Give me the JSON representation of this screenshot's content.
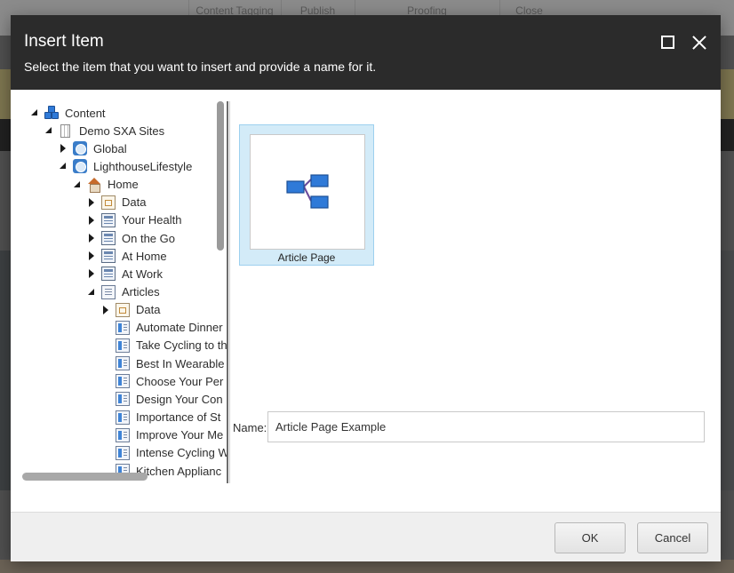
{
  "background": {
    "tabs": [
      "Content Tagging",
      "Publish",
      "Proofing",
      "Close"
    ]
  },
  "dialog": {
    "title": "Insert Item",
    "subtitle": "Select the item that you want to insert and provide a name for it.",
    "maximize_icon": "maximize-icon",
    "close_icon": "close-icon"
  },
  "tree": {
    "nodes": [
      {
        "label": "Content",
        "icon": "content-icon",
        "state": "expanded"
      },
      {
        "label": "Demo SXA Sites",
        "icon": "building-icon",
        "state": "expanded"
      },
      {
        "label": "Global",
        "icon": "globe-icon",
        "state": "collapsed"
      },
      {
        "label": "LighthouseLifestyle",
        "icon": "globe-icon",
        "state": "expanded"
      },
      {
        "label": "Home",
        "icon": "home-icon",
        "state": "expanded"
      },
      {
        "label": "Data",
        "icon": "data-folder-icon",
        "state": "collapsed"
      },
      {
        "label": "Your Health",
        "icon": "page-icon",
        "state": "collapsed"
      },
      {
        "label": "On the Go",
        "icon": "page-icon",
        "state": "collapsed"
      },
      {
        "label": "At Home",
        "icon": "page-icon",
        "state": "collapsed"
      },
      {
        "label": "At Work",
        "icon": "page-icon",
        "state": "collapsed"
      },
      {
        "label": "Articles",
        "icon": "articles-icon",
        "state": "expanded"
      },
      {
        "label": "Data",
        "icon": "data-folder-icon",
        "state": "collapsed"
      },
      {
        "label": "Automate Dinner",
        "icon": "article-icon",
        "state": "leaf"
      },
      {
        "label": "Take Cycling to th",
        "icon": "article-icon",
        "state": "leaf"
      },
      {
        "label": "Best In Wearable",
        "icon": "article-icon",
        "state": "leaf"
      },
      {
        "label": "Choose Your Per",
        "icon": "article-icon",
        "state": "leaf"
      },
      {
        "label": "Design Your Con",
        "icon": "article-icon",
        "state": "leaf"
      },
      {
        "label": "Importance of St",
        "icon": "article-icon",
        "state": "leaf"
      },
      {
        "label": "Improve Your Me",
        "icon": "article-icon",
        "state": "leaf"
      },
      {
        "label": "Intense Cycling W",
        "icon": "article-icon",
        "state": "leaf"
      },
      {
        "label": "Kitchen Applianc",
        "icon": "article-icon",
        "state": "leaf"
      }
    ]
  },
  "templates": [
    {
      "label": "Article Page",
      "icon": "article-page-template-icon",
      "selected": true
    }
  ],
  "name_field": {
    "label": "Name:",
    "value": "Article Page Example"
  },
  "footer": {
    "ok_label": "OK",
    "cancel_label": "Cancel"
  },
  "colors": {
    "header_bg": "#2b2b2b",
    "tile_selected_bg": "#d3ebf8",
    "tile_selected_border": "#9dd0ef",
    "icon_blue": "#2f7ad8"
  }
}
